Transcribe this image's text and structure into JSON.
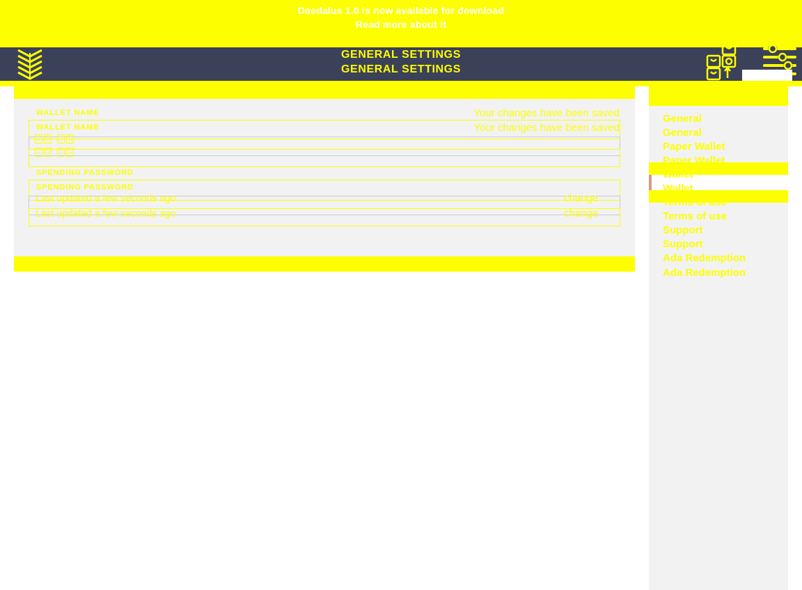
{
  "app": {
    "accent_yellow": "#fdff00",
    "topbar_bg": "#3b4159",
    "pane_bg": "#f2f2f3",
    "active_marker": "#d6998f"
  },
  "news_banner": {
    "line1": "Daedalus 1.0 is now available for download",
    "line2": "Read more about it"
  },
  "topbar": {
    "title": "GENERAL SETTINGS",
    "title_ghost": "GENERAL SETTINGS",
    "logo_name": "daedalus-logo",
    "icons": [
      {
        "name": "wallets-icon",
        "label": "Wallets"
      },
      {
        "name": "settings-sliders-icon",
        "label": "Settings"
      }
    ]
  },
  "main": {
    "wallet_name": {
      "label": "WALLET NAME",
      "label_ghost": "WALLET NAME",
      "value": " ",
      "value_codepoints": [
        "C9CU",
        "ACUU",
        "CDCU",
        "ACUU"
      ],
      "value_codepoints_2": [
        "C9CU",
        "ACUU",
        "CDCU",
        "ACUU"
      ],
      "saved_message": "Your changes have been saved",
      "saved_message_ghost": "Your changes have been saved"
    },
    "spending_password": {
      "label": "SPENDING PASSWORD",
      "label_ghost": "SPENDING PASSWORD",
      "last_updated": "Last updated a few seconds ago",
      "last_updated_ghost": "Last updated a few seconds ago",
      "change_label": "change",
      "change_label_ghost": "change"
    }
  },
  "sidebar": {
    "items": [
      {
        "label": "General",
        "name": "sidebar-item-general",
        "active": false
      },
      {
        "label": "General",
        "name": "sidebar-item-general-ghost",
        "active": false
      },
      {
        "label": "Paper Wallet",
        "name": "sidebar-item-paper-wallet",
        "active": false
      },
      {
        "label": "Paper Wallet",
        "name": "sidebar-item-paper-wallet-ghost",
        "active": false
      },
      {
        "label": "Wallet",
        "name": "sidebar-item-wallet",
        "active": true
      },
      {
        "label": "Wallet",
        "name": "sidebar-item-wallet-ghost",
        "active": true
      },
      {
        "label": "Terms of use",
        "name": "sidebar-item-terms-of-use",
        "active": false
      },
      {
        "label": "Terms of use",
        "name": "sidebar-item-terms-of-use-ghost",
        "active": false
      },
      {
        "label": "Support",
        "name": "sidebar-item-support",
        "active": false
      },
      {
        "label": "Support",
        "name": "sidebar-item-support-ghost",
        "active": false
      },
      {
        "label": "Ada Redemption",
        "name": "sidebar-item-ada-redemption",
        "active": false
      },
      {
        "label": "Ada Redemption",
        "name": "sidebar-item-ada-redemption-ghost",
        "active": false
      }
    ]
  }
}
